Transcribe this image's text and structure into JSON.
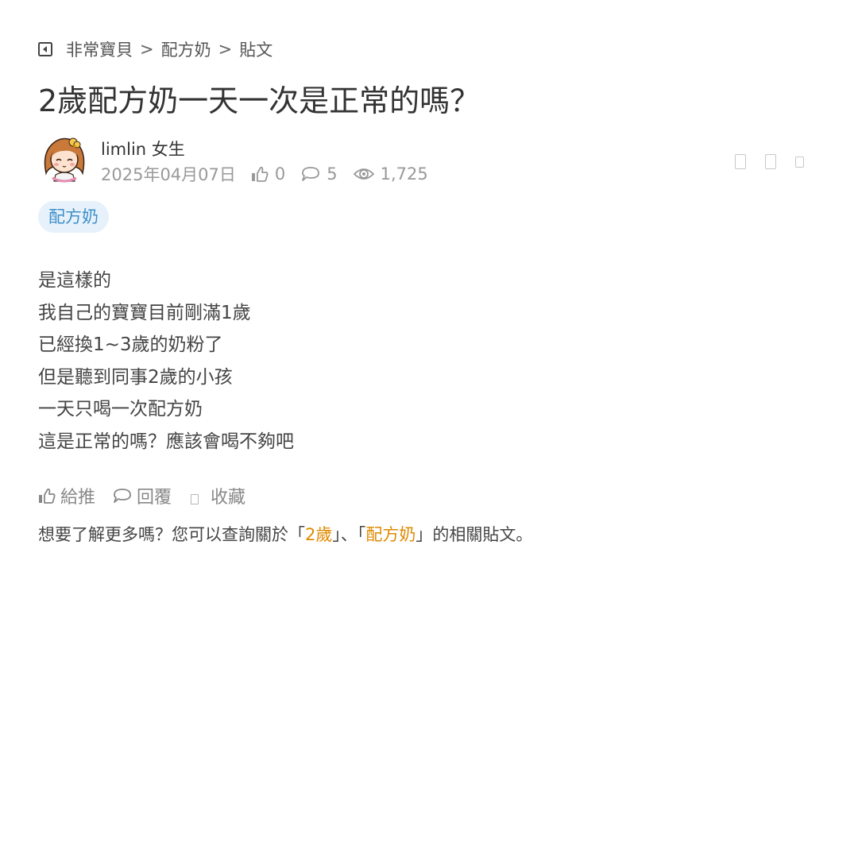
{
  "breadcrumb": {
    "items": [
      "非常寶貝",
      "配方奶",
      "貼文"
    ],
    "separator": ">"
  },
  "post": {
    "title": "2歲配方奶一天一次是正常的嗎？",
    "author": {
      "name": "limlin",
      "gender": "女生"
    },
    "date": "2025年04月07日",
    "likes": "0",
    "comments": "5",
    "views": "1,725",
    "tag": "配方奶",
    "content": [
      "是這樣的",
      "我自己的寶寶目前剛滿1歲",
      "已經換1~3歲的奶粉了",
      "但是聽到同事2歲的小孩",
      "一天只喝一次配方奶",
      "這是正常的嗎？應該會喝不夠吧"
    ]
  },
  "actions": {
    "like": "給推",
    "reply": "回覆",
    "favorite": "收藏"
  },
  "related": {
    "prefix": "想要了解更多嗎？您可以查詢關於「",
    "link1": "2歲",
    "mid": "」、「",
    "link2": "配方奶",
    "suffix": "」的相關貼文。"
  },
  "colors": {
    "accent_link": "#e08a00",
    "tag_bg": "#e6f1fb",
    "tag_text": "#3d8ec7"
  },
  "icons": [
    "back-arrow-icon",
    "avatar-girl",
    "thumbs-up-icon",
    "comment-icon",
    "eye-icon",
    "placeholder-icon"
  ]
}
